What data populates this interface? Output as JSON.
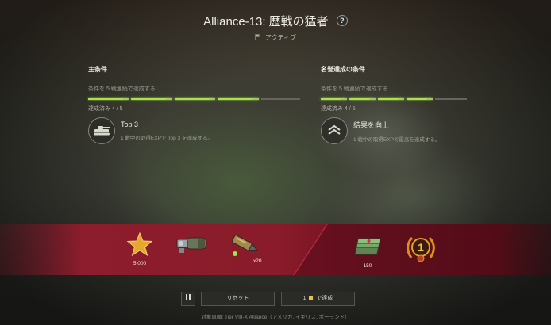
{
  "header": {
    "title": "Alliance-13: 歴戦の猛者",
    "help_symbol": "?",
    "status": "アクティブ"
  },
  "primary": {
    "heading": "主条件",
    "condition": "条件を 5 戦連続で達成する",
    "segments": [
      {
        "pct": "10%",
        "done": true
      },
      {
        "pct": "10%",
        "done": true
      },
      {
        "pct": "10%",
        "done": true
      },
      {
        "pct": "10%",
        "done": true
      },
      {
        "pct": "",
        "done": false
      }
    ],
    "count": "達成済み 4 / 5",
    "task_title": "Top 3",
    "task_desc": "1 戦中の取得EXPで Top 3 を達成する。"
  },
  "honor": {
    "heading": "名誉達成の条件",
    "condition": "条件を 5 戦連続で達成する",
    "segments": [
      {
        "pct": "10%",
        "done": true
      },
      {
        "pct": "10%",
        "done": true
      },
      {
        "pct": "10%",
        "done": true
      },
      {
        "pct": "10%",
        "done": true
      },
      {
        "pct": "",
        "done": false
      }
    ],
    "count": "達成済み 4 / 5",
    "task_title": "結果を向上",
    "task_desc": "1 戦中の取得EXPで最高を達成する。"
  },
  "rewards": {
    "star_value": "5,000",
    "ammo_count": "x20",
    "cash_value": "150",
    "medal_number": "1"
  },
  "buttons": {
    "reset": "リセット",
    "complete_prefix": "1",
    "complete_suffix": "で達成"
  },
  "footer": "対象車輌: Tier VIII-X Alliance（アメリカ, イギリス, ポーランド）",
  "colors": {
    "progress_done": "#a8e34a",
    "band_red": "#8d1d2c",
    "band_dark_red": "#5a0d18",
    "gold": "#e0a423"
  }
}
